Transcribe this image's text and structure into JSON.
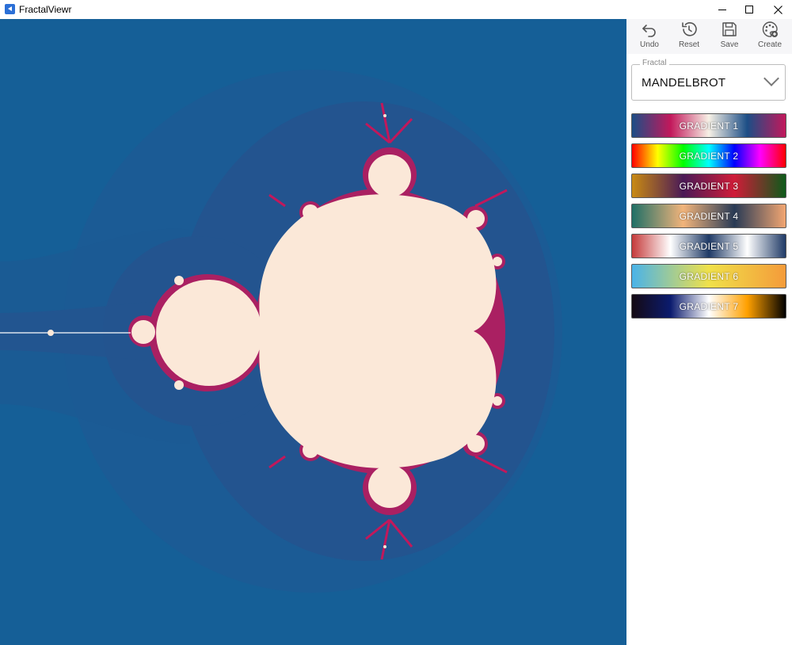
{
  "window": {
    "title": "FractalViewr"
  },
  "toolbar": {
    "undo_label": "Undo",
    "reset_label": "Reset",
    "save_label": "Save",
    "create_label": "Create"
  },
  "fractal_select": {
    "legend": "Fractal",
    "value": "MANDELBROT"
  },
  "gradients": [
    {
      "label": "GRADIENT 1",
      "colors": [
        "#1c4e86",
        "#c2185b",
        "#f7f1e6",
        "#1c4e86",
        "#c2185b"
      ]
    },
    {
      "label": "GRADIENT 2",
      "colors": [
        "#ff0000",
        "#ffff00",
        "#00ff00",
        "#00ffff",
        "#0000ff",
        "#ff00ff",
        "#ff0000"
      ]
    },
    {
      "label": "GRADIENT 3",
      "colors": [
        "#c98a13",
        "#4a1a57",
        "#d01c38",
        "#0d5a1a"
      ]
    },
    {
      "label": "GRADIENT 4",
      "colors": [
        "#1f6f66",
        "#f2b47b",
        "#283a55",
        "#f2a672"
      ]
    },
    {
      "label": "GRADIENT 5",
      "colors": [
        "#c53a3a",
        "#ffffff",
        "#1f3a66",
        "#ffffff",
        "#1f3a66"
      ]
    },
    {
      "label": "GRADIENT 6",
      "colors": [
        "#4ab3e8",
        "#f0e14a",
        "#f49b3a"
      ]
    },
    {
      "label": "GRADIENT 7",
      "colors": [
        "#150a13",
        "#0b1b6e",
        "#ffffff",
        "#ffa000",
        "#000000"
      ]
    }
  ],
  "colors": {
    "fractal_background": "#155f97",
    "fractal_interior": "#fbe8d8",
    "fractal_edge": "#c2185b"
  }
}
